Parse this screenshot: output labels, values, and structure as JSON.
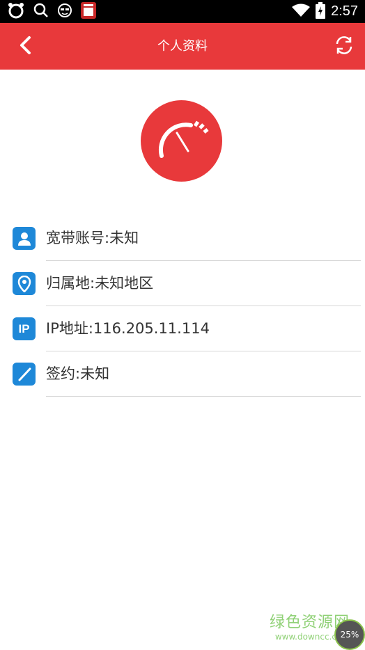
{
  "status_bar": {
    "time": "2:57",
    "icons": [
      "cat-icon",
      "search-icon",
      "face-icon",
      "notification-app-icon",
      "wifi-icon",
      "battery-icon"
    ]
  },
  "app_bar": {
    "title": "个人资料",
    "back_icon": "chevron-left-icon",
    "refresh_icon": "refresh-icon",
    "color": "#e8393b"
  },
  "profile": {
    "avatar_icon": "speedometer-icon"
  },
  "info_items": [
    {
      "icon": "user-icon",
      "label": "宽带账号:未知"
    },
    {
      "icon": "location-pin-icon",
      "label": "归属地:未知地区"
    },
    {
      "icon": "ip-icon",
      "icon_text": "IP",
      "label": "IP地址:116.205.11.114"
    },
    {
      "icon": "pen-icon",
      "label": "签约:未知"
    }
  ],
  "watermark": {
    "title": "绿色资源网",
    "url": "www.downcc.com"
  },
  "progress_badge": "25%",
  "colors": {
    "accent": "#e8393b",
    "icon_blue": "#1e88d8"
  }
}
